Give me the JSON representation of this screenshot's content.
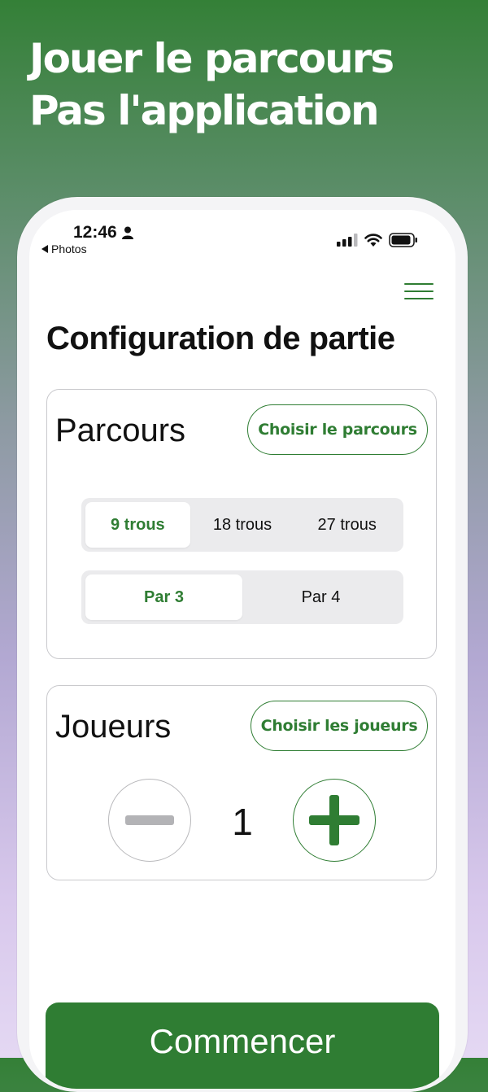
{
  "headline": {
    "line1": "Jouer le parcours",
    "line2": "Pas l'application"
  },
  "status_bar": {
    "time": "12:46",
    "back_label": "Photos"
  },
  "page_title": "Configuration de partie",
  "course_card": {
    "title": "Parcours",
    "choose_button": "Choisir le parcours",
    "holes_options": [
      "9 trous",
      "18 trous",
      "27 trous"
    ],
    "holes_selected": "9 trous",
    "par_options": [
      "Par 3",
      "Par 4"
    ],
    "par_selected": "Par 3"
  },
  "players_card": {
    "title": "Joueurs",
    "choose_button": "Choisir les joueurs",
    "count": "1"
  },
  "start_button": "Commencer",
  "colors": {
    "accent": "#2f7d33",
    "segment_bg": "#ebebed"
  }
}
